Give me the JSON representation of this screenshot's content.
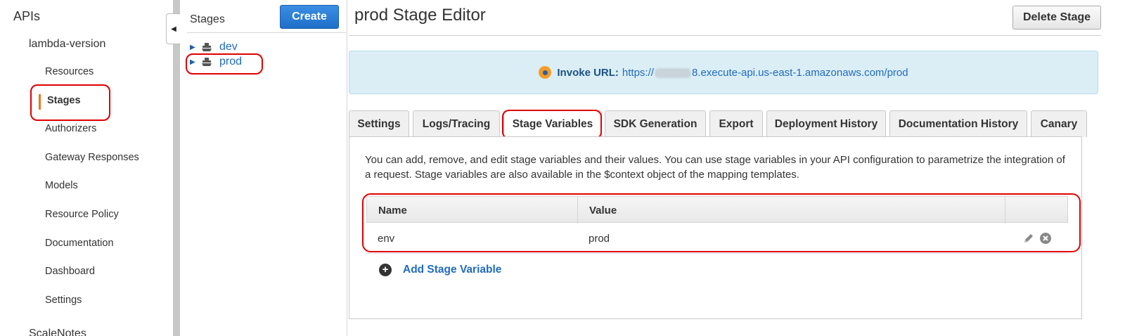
{
  "nav": {
    "root": "APIs",
    "api_name": "lambda-version",
    "items": [
      {
        "label": "Resources"
      },
      {
        "label": "Stages"
      },
      {
        "label": "Authorizers"
      },
      {
        "label": "Gateway Responses"
      },
      {
        "label": "Models"
      },
      {
        "label": "Resource Policy"
      },
      {
        "label": "Documentation"
      },
      {
        "label": "Dashboard"
      },
      {
        "label": "Settings"
      }
    ],
    "next_api": "ScaleNotes"
  },
  "stages_panel": {
    "title": "Stages",
    "create_label": "Create",
    "stages": [
      {
        "label": "dev"
      },
      {
        "label": "prod"
      }
    ]
  },
  "editor": {
    "title": "prod Stage Editor",
    "delete_label": "Delete Stage",
    "invoke_label": "Invoke URL:",
    "invoke_url_prefix": "https://",
    "invoke_url_suffix": "8.execute-api.us-east-1.amazonaws.com/prod",
    "tabs": [
      {
        "label": "Settings"
      },
      {
        "label": "Logs/Tracing"
      },
      {
        "label": "Stage Variables"
      },
      {
        "label": "SDK Generation"
      },
      {
        "label": "Export"
      },
      {
        "label": "Deployment History"
      },
      {
        "label": "Documentation History"
      },
      {
        "label": "Canary"
      }
    ],
    "active_tab": "Stage Variables",
    "description": "You can add, remove, and edit stage variables and their values. You can use stage variables in your API configuration to parametrize the integration of a request. Stage variables are also available in the $context object of the mapping templates.",
    "table": {
      "columns": [
        "Name",
        "Value",
        ""
      ],
      "rows": [
        {
          "name": "env",
          "value": "prod"
        }
      ]
    },
    "add_label": "Add Stage Variable"
  },
  "colors": {
    "accent_blue": "#1f6bbf",
    "nav_active_bar": "#e7781e",
    "annotation_red": "#e00000",
    "invoke_bg": "#dbeef6"
  }
}
